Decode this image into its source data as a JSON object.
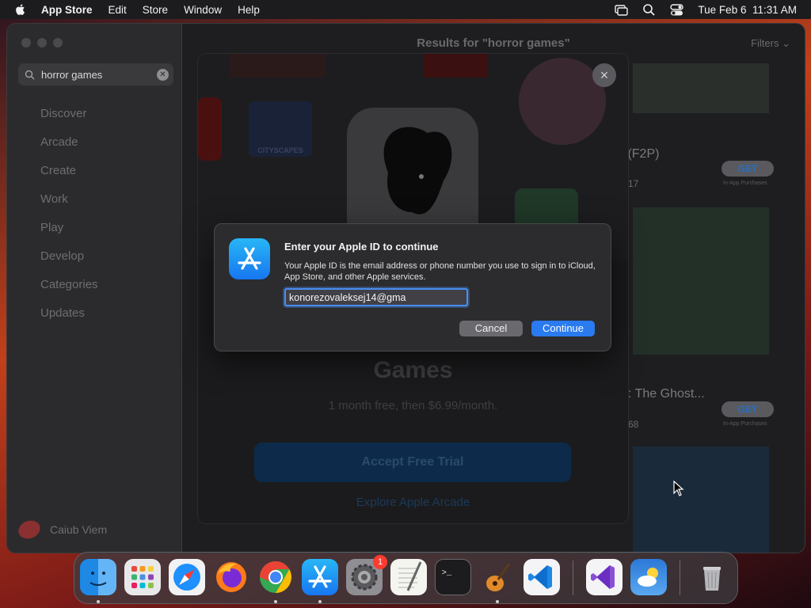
{
  "menubar": {
    "app_name": "App Store",
    "menus": [
      "Edit",
      "Store",
      "Window",
      "Help"
    ],
    "datetime": "Tue Feb 6  11:31 AM"
  },
  "sidebar": {
    "search_value": "horror games",
    "items": [
      "Discover",
      "Arcade",
      "Create",
      "Work",
      "Play",
      "Develop",
      "Categories",
      "Updates"
    ],
    "user_name": "Caiub Viem"
  },
  "main": {
    "results_title": "Results for \"horror games\"",
    "filters_label": "Filters",
    "results": [
      {
        "title_fragment": "s (F2P)",
        "rating_fragment": "17",
        "get_label": "GET",
        "iap_note": "In-App Purchases"
      },
      {
        "title_fragment": ": The Ghost...",
        "rating_fragment": "68",
        "get_label": "GET",
        "iap_note": "In-App Purchases"
      }
    ]
  },
  "arcade_sheet": {
    "close_symbol": "×",
    "collage_text": "CITYSCAPES",
    "headline": "Games",
    "trial_text": "1 month free, then $6.99/month.",
    "accept_label": "Accept Free Trial",
    "explore_label": "Explore Apple Arcade"
  },
  "dialog": {
    "title": "Enter your Apple ID to continue",
    "description": "Your Apple ID is the email address or phone number you use to sign in to iCloud, App Store, and other Apple services.",
    "field_value": "konorezovaleksej14@gma",
    "cancel_label": "Cancel",
    "continue_label": "Continue"
  },
  "dock": {
    "apps": [
      "Finder",
      "Launchpad",
      "Safari",
      "Firefox",
      "Chrome",
      "App Store",
      "System Settings",
      "TextEdit",
      "Terminal",
      "GarageBand",
      "VS Code",
      "Visual Studio",
      "Weather",
      "Trash"
    ],
    "system_settings_badge": "1"
  },
  "colors": {
    "accent": "#2a7af0",
    "badge": "#ff3b30"
  }
}
